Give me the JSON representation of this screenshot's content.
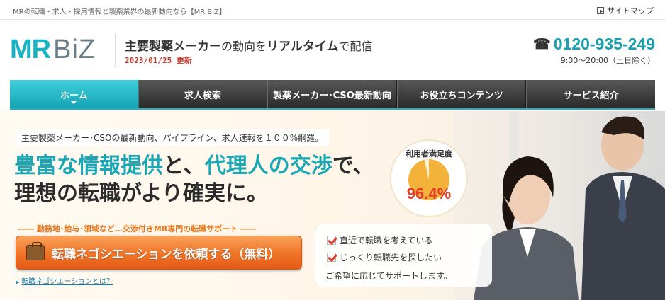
{
  "topbar": {
    "tagline": "MRの転職・求人・採用情報と製薬業界の最新動向なら【MR BiZ】",
    "sitemap": "サイトマップ"
  },
  "header": {
    "logo_mr": "MR",
    "logo_biz": "BiZ",
    "headline_1": "主要製薬メーカー",
    "headline_2": "の動向を",
    "headline_3": "リアルタイム",
    "headline_4": "で配信",
    "updated": "2023/01/25 更新",
    "phone": "0120-935-249",
    "hours": "9:00〜20:00（土日除く）"
  },
  "nav": {
    "items": [
      {
        "label": "ホーム"
      },
      {
        "label": "求人検索"
      },
      {
        "label": "製薬メーカー･CSO最新動向"
      },
      {
        "label": "お役立ちコンテンツ"
      },
      {
        "label": "サービス紹介"
      }
    ]
  },
  "hero": {
    "sub": "主要製薬メーカー･CSOの最新動向、パイプライン、求人速報を１００%網羅。",
    "main_1a": "豊富な情報提供",
    "main_1b": "と、",
    "main_1c": "代理人の交渉",
    "main_1d": "で、",
    "main_2": "理想の転職がより確実に。",
    "badge_title": "利用者満足度",
    "badge_value": "96.4%",
    "satisfaction_fraction": 0.964,
    "support_label": "―― 勤務地･給与･領域など…交渉付きMR専門の転職サポート ――",
    "cta": "転職ネゴシエーションを依頼する（無料）",
    "cta_link": "転職ネゴシエーションとは？",
    "checks": [
      "直近で転職を考えている",
      "じっくり転職先を探したい"
    ],
    "check_note": "ご希望に応じてサポートします。"
  },
  "colors": {
    "teal": "#1ab3c2",
    "orange": "#f0772a",
    "red": "#e53b2c"
  }
}
